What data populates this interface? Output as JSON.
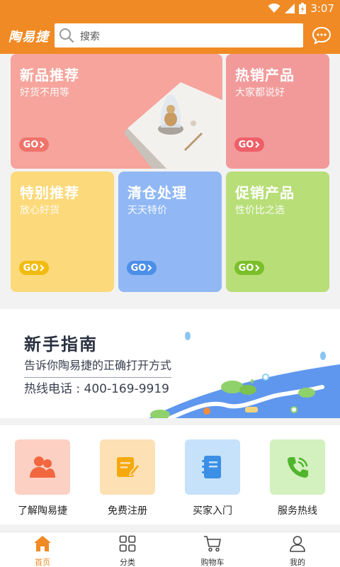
{
  "status_bar": {
    "time": "3:07"
  },
  "header": {
    "logo": "陶易捷",
    "search_placeholder": "搜索"
  },
  "tiles": [
    {
      "title": "新品推荐",
      "subtitle": "好货不用等",
      "go": "GO"
    },
    {
      "title": "热销产品",
      "subtitle": "大家都说好",
      "go": "GO"
    },
    {
      "title": "特别推荐",
      "subtitle": "放心好货",
      "go": "GO"
    },
    {
      "title": "清仓处理",
      "subtitle": "天天特价",
      "go": "GO"
    },
    {
      "title": "促销产品",
      "subtitle": "性价比之选",
      "go": "GO"
    }
  ],
  "guide": {
    "title": "新手指南",
    "subtitle": "告诉你陶易捷的正确打开方式",
    "hotline": "热线电话 : 400-169-9919"
  },
  "shortcuts": [
    {
      "label": "了解陶易捷",
      "icon": "people-icon",
      "color": "#fdd0c4"
    },
    {
      "label": "免费注册",
      "icon": "edit-note-icon",
      "color": "#fde0b4"
    },
    {
      "label": "买家入门",
      "icon": "notebook-icon",
      "color": "#c6e2fb"
    },
    {
      "label": "服务热线",
      "icon": "phone-icon",
      "color": "#d3f0bf"
    }
  ],
  "tabs": [
    {
      "label": "首页",
      "icon": "home-icon",
      "active": true
    },
    {
      "label": "分类",
      "icon": "grid-icon",
      "active": false
    },
    {
      "label": "购物车",
      "icon": "cart-icon",
      "active": false
    },
    {
      "label": "我的",
      "icon": "user-icon",
      "active": false
    }
  ],
  "colors": {
    "brand": "#f08a24",
    "tile_new": "#f6a49c",
    "tile_hot": "#f29a9a",
    "tile_special": "#fcd97a",
    "tile_clearance": "#91b8f4",
    "tile_promo": "#b8de78"
  }
}
